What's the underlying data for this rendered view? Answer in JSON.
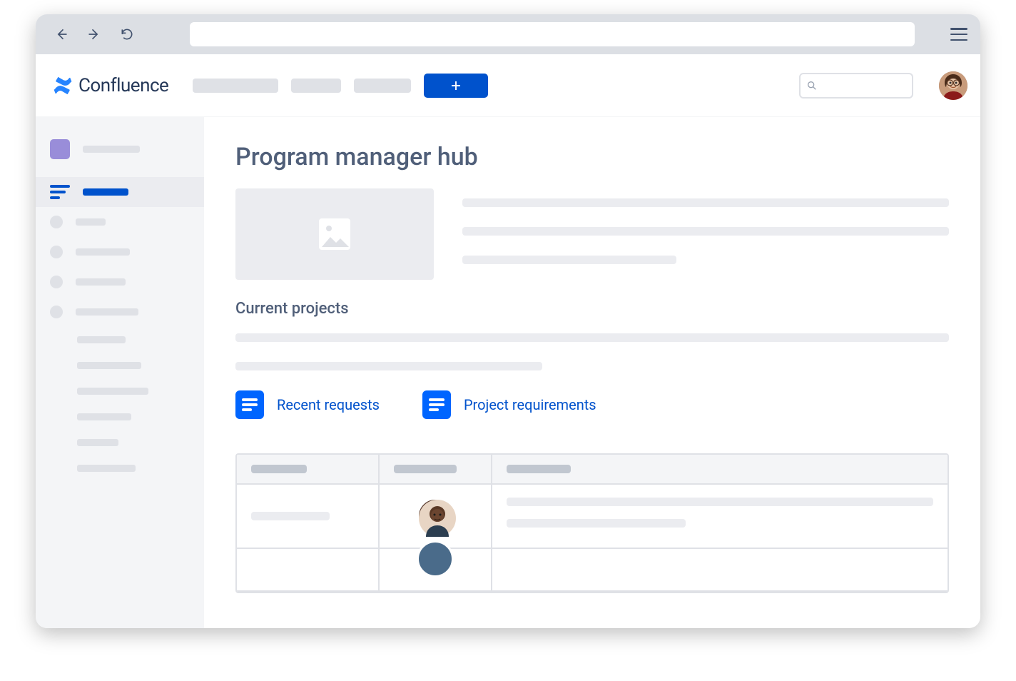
{
  "app": {
    "name": "Confluence"
  },
  "page": {
    "title": "Program manager hub",
    "section_current_projects": "Current projects"
  },
  "links": {
    "recent_requests": "Recent requests",
    "project_requirements": "Project requirements"
  }
}
